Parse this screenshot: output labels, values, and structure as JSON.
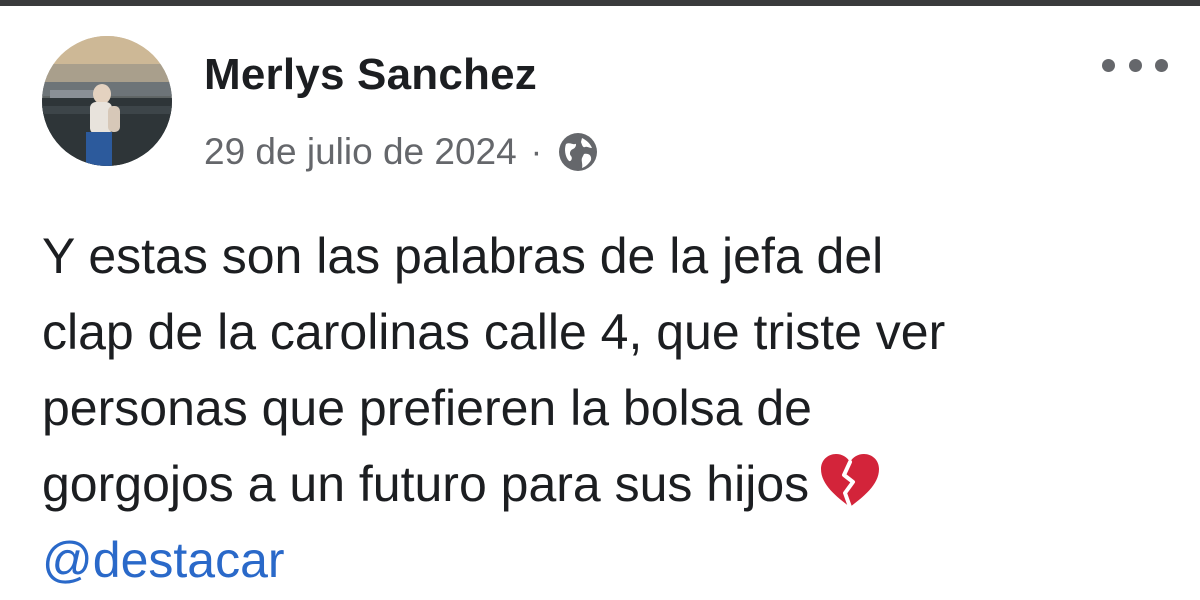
{
  "post": {
    "author_name": "Merlys Sanchez",
    "date": "29 de julio de 2024",
    "separator": "·",
    "privacy_icon": "globe-icon",
    "more_icon": "more-options-icon",
    "text_lines": [
      "Y estas son las palabras de la jefa del",
      "clap de la carolinas calle 4, que triste ver",
      "personas que prefieren la bolsa de",
      "gorgojos  a un futuro para sus hijos"
    ],
    "trailing_emoji_icon": "broken-heart-icon",
    "mention": "@destacar"
  },
  "colors": {
    "name": "#1c1e21",
    "meta": "#65676b",
    "link": "#2a69c9",
    "heart": "#d3243a"
  }
}
